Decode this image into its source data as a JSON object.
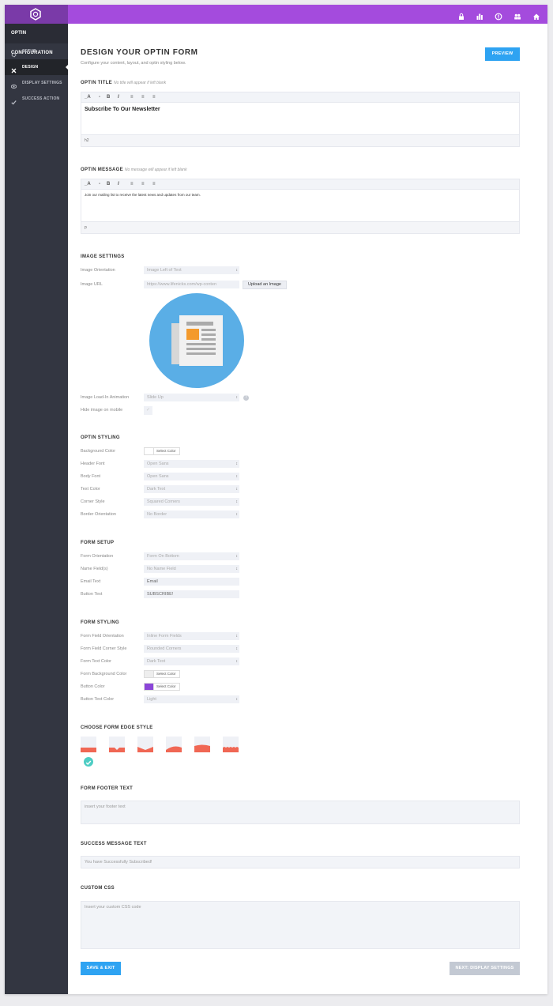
{
  "topbar": {
    "icons": [
      "lock-icon",
      "bar-chart-icon",
      "circle-info-icon",
      "users-icon",
      "home-icon"
    ]
  },
  "sidebar": {
    "header": "OPTIN CONFIGURATION",
    "items": [
      {
        "label": "SETUP",
        "icon": "gear-icon"
      },
      {
        "label": "DESIGN",
        "icon": "tools-icon"
      },
      {
        "label": "DISPLAY SETTINGS",
        "icon": "eye-icon"
      },
      {
        "label": "SUCCESS ACTION",
        "icon": "check-icon"
      }
    ]
  },
  "page": {
    "title": "DESIGN YOUR OPTIN FORM",
    "subtitle": "Configure your content, layout, and optin styling below.",
    "preview": "PREVIEW"
  },
  "optin_title": {
    "label": "OPTIN TITLE",
    "hint": "No title will appear if left blank",
    "content": "Subscribe To Our Newsletter",
    "status": "h2"
  },
  "optin_message": {
    "label": "OPTIN MESSAGE",
    "hint": "No message will appear if left blank",
    "content": "Join our mailing list to receive the latest news and updates from our team.",
    "status": "p"
  },
  "toolbar": {
    "format": "_A",
    "dash": "-",
    "bold": "B",
    "italic": "I"
  },
  "image_settings": {
    "label": "IMAGE SETTINGS",
    "orientation_label": "Image Orientation",
    "orientation_value": "Image Left of Text",
    "url_label": "Image URL",
    "url_value": "https://www.lifenicks.com/wp-conten",
    "upload_button": "Upload an Image",
    "animation_label": "Image Load-In Animation",
    "animation_value": "Slide Up",
    "hide_mobile_label": "Hide image on mobile"
  },
  "optin_styling": {
    "label": "OPTIN STYLING",
    "rows": [
      {
        "label": "Background Color",
        "type": "color",
        "value": "Select Color",
        "swatch": "#ffffff"
      },
      {
        "label": "Header Font",
        "type": "select",
        "value": "Open Sans"
      },
      {
        "label": "Body Font",
        "type": "select",
        "value": "Open Sans"
      },
      {
        "label": "Text Color",
        "type": "select",
        "value": "Dark Text"
      },
      {
        "label": "Corner Style",
        "type": "select",
        "value": "Squared Corners"
      },
      {
        "label": "Border Orientation",
        "type": "select",
        "value": "No Border"
      }
    ]
  },
  "form_setup": {
    "label": "FORM SETUP",
    "rows": [
      {
        "label": "Form Orientation",
        "type": "select",
        "value": "Form On Bottom"
      },
      {
        "label": "Name Field(s)",
        "type": "select",
        "value": "No Name Field"
      },
      {
        "label": "Email Text",
        "type": "input",
        "value": "Email"
      },
      {
        "label": "Button Text",
        "type": "input",
        "value": "SUBSCRIBE!"
      }
    ]
  },
  "form_styling": {
    "label": "FORM STYLING",
    "rows": [
      {
        "label": "Form Field Orientation",
        "type": "select",
        "value": "Inline Form Fields"
      },
      {
        "label": "Form Field Corner Style",
        "type": "select",
        "value": "Rounded Corners"
      },
      {
        "label": "Form Text Color",
        "type": "select",
        "value": "Dark Text"
      },
      {
        "label": "Form Background Color",
        "type": "color",
        "value": "Select Color",
        "swatch": "#eeeeee"
      },
      {
        "label": "Button Color",
        "type": "color",
        "value": "Select Color",
        "swatch": "#8b46d8"
      },
      {
        "label": "Button Text Color",
        "type": "select",
        "value": "Light"
      }
    ]
  },
  "edge_style": {
    "label": "CHOOSE FORM EDGE STYLE",
    "selected": 0,
    "count": 6
  },
  "footer_text": {
    "label": "FORM FOOTER TEXT",
    "placeholder": "insert your footer text"
  },
  "success_message": {
    "label": "SUCCESS MESSAGE TEXT",
    "value": "You have Successfully Subscribed!"
  },
  "custom_css": {
    "label": "CUSTOM CSS",
    "placeholder": "Insert your custom CSS code"
  },
  "footer_buttons": {
    "save": "SAVE & EXIT",
    "next": "NEXT: DISPLAY SETTINGS"
  },
  "colors": {
    "accent": "#a44bdd",
    "blue": "#2ea3f2",
    "edge": "#f06754",
    "check": "#4ecdc4"
  }
}
